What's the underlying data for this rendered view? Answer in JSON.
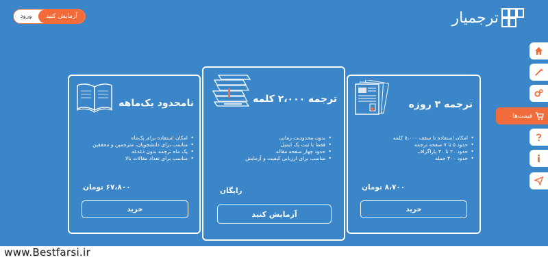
{
  "header": {
    "brand_name": "ترجمیار",
    "login_label": "ورود",
    "trial_label": "آزمایش کنید"
  },
  "sidenav": {
    "items": [
      {
        "icon": "home-icon"
      },
      {
        "icon": "magic-wand-icon"
      },
      {
        "icon": "gears-icon"
      },
      {
        "icon": "cart-icon",
        "label": "قیمت‌ها",
        "active": true
      },
      {
        "icon": "question-icon"
      },
      {
        "icon": "info-icon"
      },
      {
        "icon": "send-icon"
      }
    ]
  },
  "plans": [
    {
      "title": "ترجمه ۳ روزه",
      "features": [
        "امکان استفاده تا سقف ۵،۰۰۰ کلمه",
        "حدود ۵ تا ۷ صفحه ترجمه",
        "حدود ۲۰ تا ۳۰ پاراگراف",
        "حدود ۳۰۰ جمله"
      ],
      "price": "۸،۷۰۰ تومان",
      "button": "خرید"
    },
    {
      "title": "ترجمه ۲،۰۰۰ کلمه",
      "features": [
        "بدون محدودیت زمانی",
        "فقط با ثبت یک ایمیل",
        "حدود چهار صفحه مقاله",
        "مناسب برای ارزیابی کیفیت و آزمایش"
      ],
      "price": "رایگان",
      "button": "آزمایش کنید"
    },
    {
      "title": "نامحدود یک‌ماهه",
      "features": [
        "امکان استفاده برای یک‌ماه",
        "مناسب برای دانشجویان، مترجمین و محققین",
        "یک ماه ترجمه بدون دغدغه",
        "مناسب برای تعداد مقالات بالا"
      ],
      "price": "۶۷،۸۰۰ تومان",
      "button": "خرید"
    }
  ],
  "watermark": "www.Bestfarsi.ir",
  "colors": {
    "background": "#3a86c8",
    "accent": "#f26b3a",
    "card_border": "#ffffff"
  }
}
